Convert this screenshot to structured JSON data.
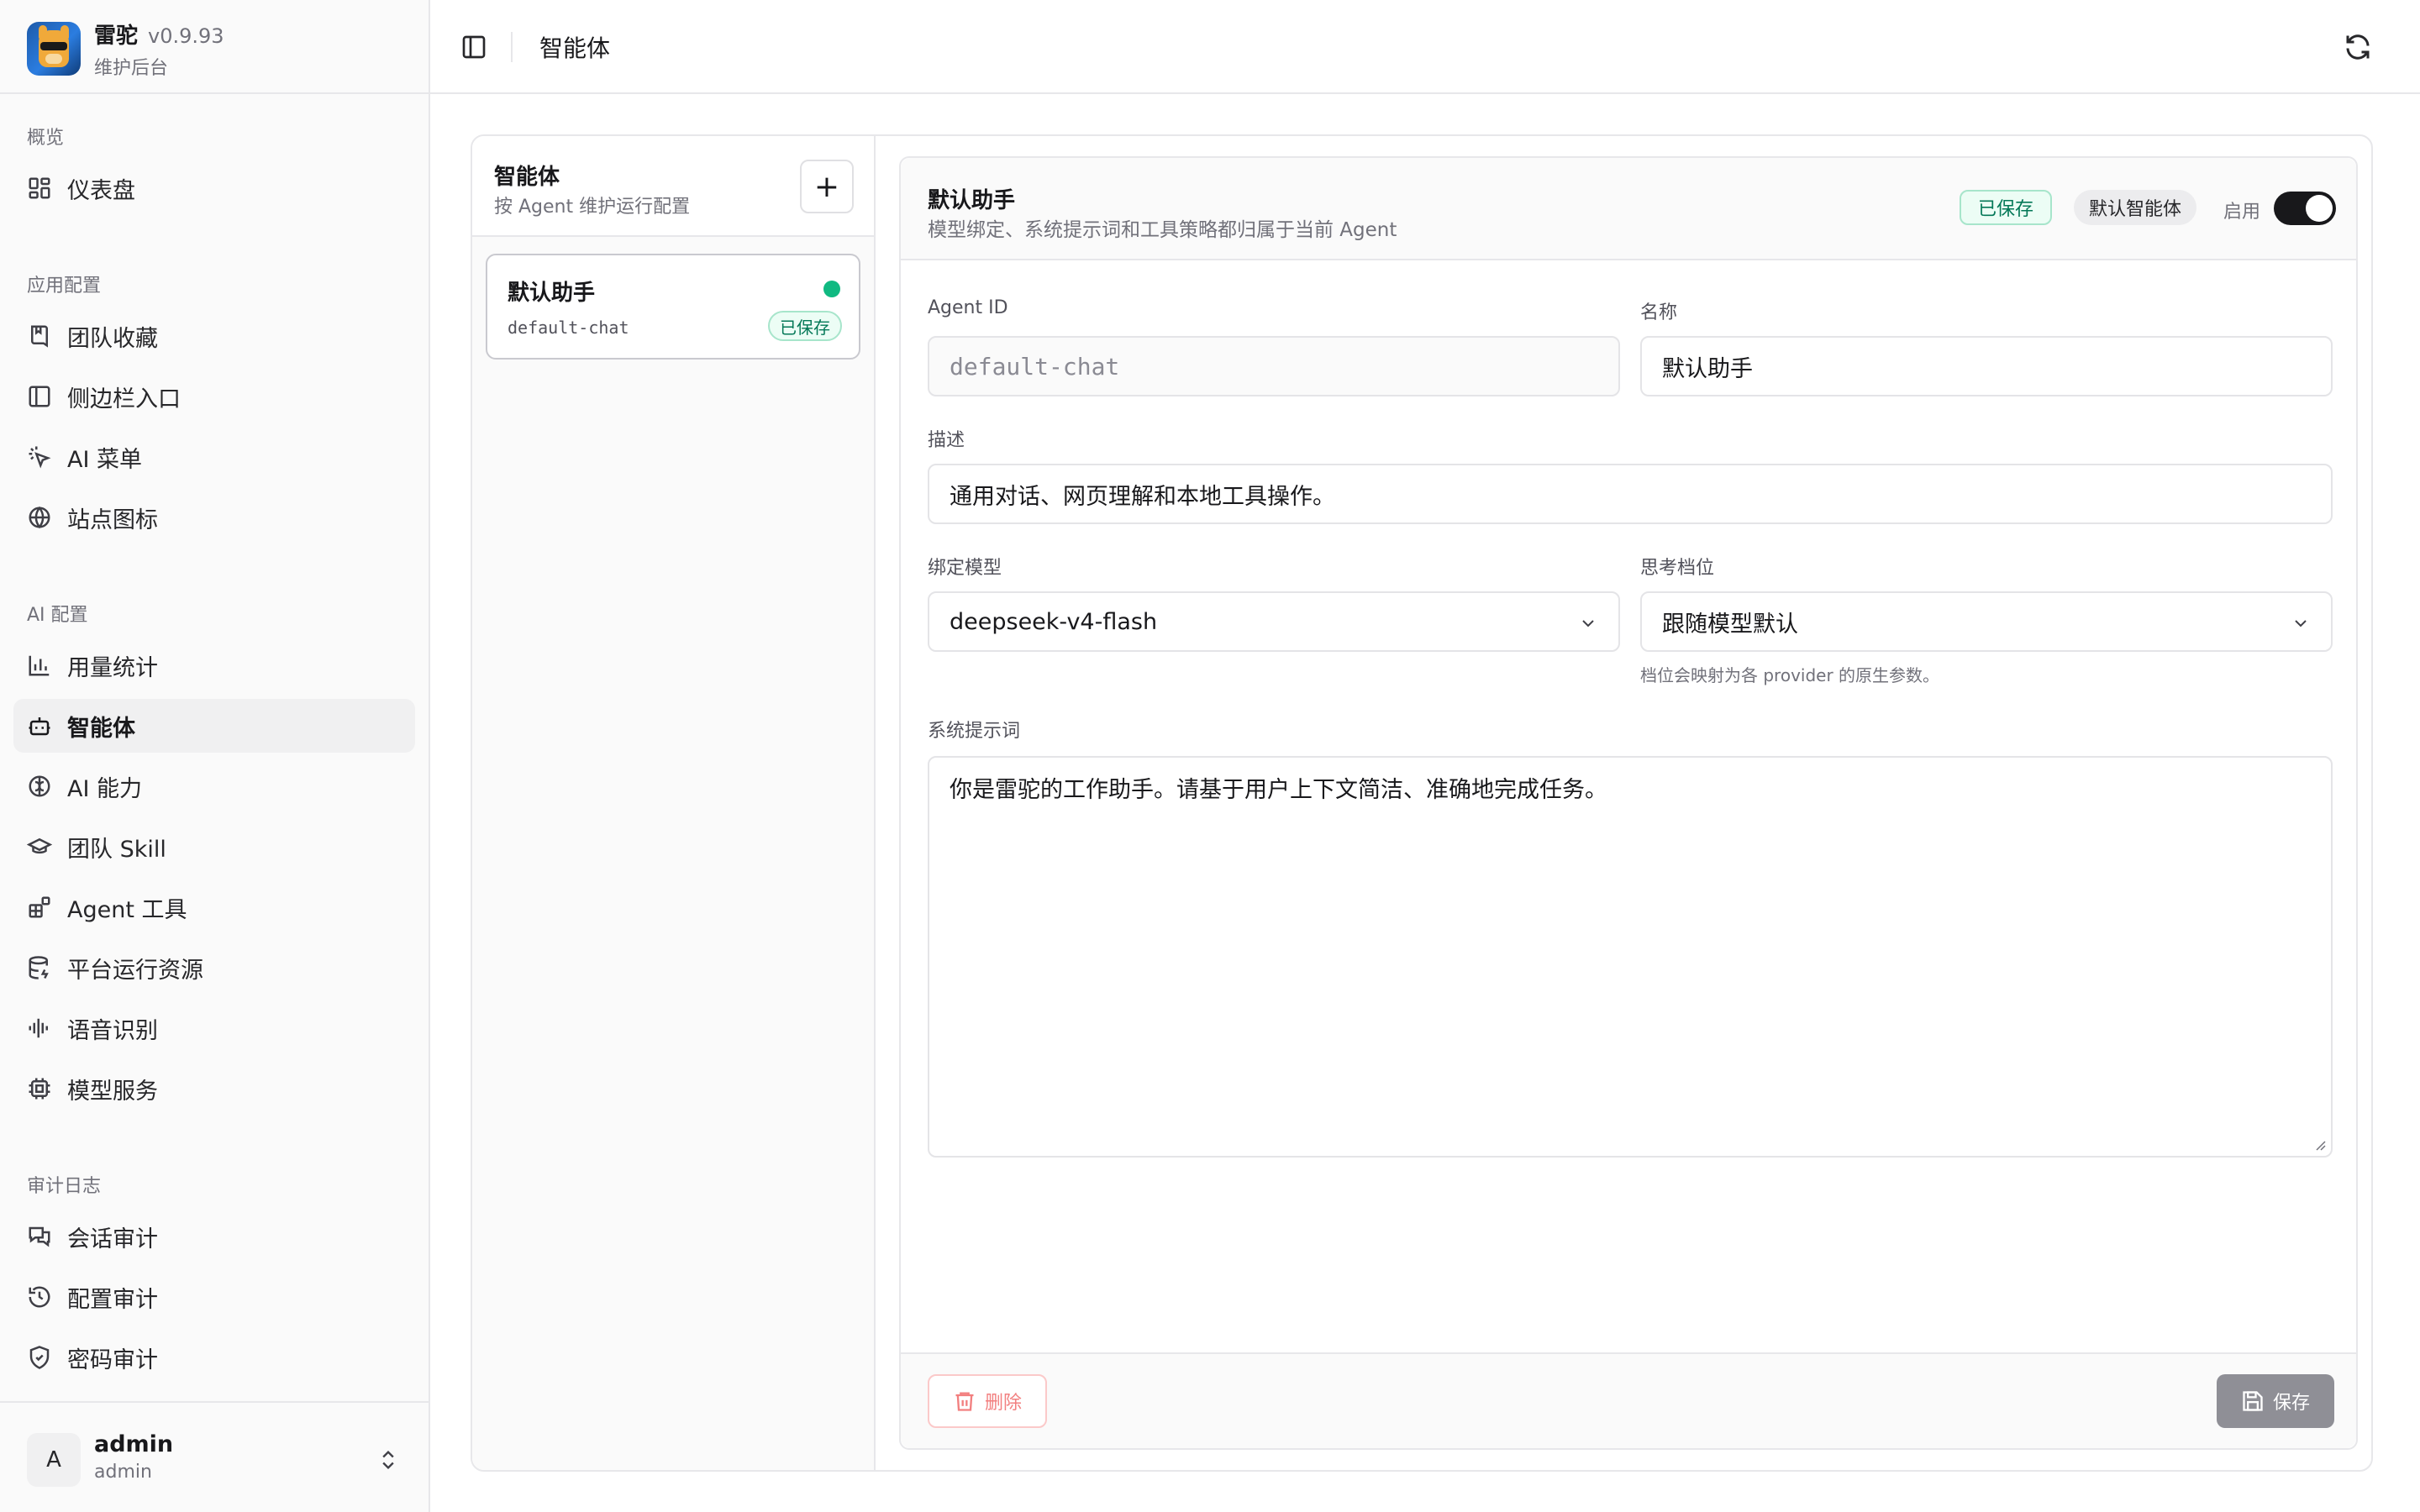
{
  "app": {
    "name": "雷驼",
    "version": "v0.9.93",
    "subtitle": "维护后台"
  },
  "sidebar": {
    "groups": [
      {
        "label": "概览",
        "items": [
          {
            "label": "仪表盘",
            "icon": "dashboard-icon"
          }
        ]
      },
      {
        "label": "应用配置",
        "items": [
          {
            "label": "团队收藏",
            "icon": "bookmark-icon"
          },
          {
            "label": "侧边栏入口",
            "icon": "sidebar-panel-icon"
          },
          {
            "label": "AI 菜单",
            "icon": "pointer-sparkle-icon"
          },
          {
            "label": "站点图标",
            "icon": "globe-icon"
          }
        ]
      },
      {
        "label": "AI 配置",
        "items": [
          {
            "label": "用量统计",
            "icon": "bar-chart-icon"
          },
          {
            "label": "智能体",
            "icon": "bot-icon",
            "active": true
          },
          {
            "label": "AI 能力",
            "icon": "brain-icon"
          },
          {
            "label": "团队 Skill",
            "icon": "graduation-cap-icon"
          },
          {
            "label": "Agent 工具",
            "icon": "blocks-icon"
          },
          {
            "label": "平台运行资源",
            "icon": "database-icon"
          },
          {
            "label": "语音识别",
            "icon": "audio-waveform-icon"
          },
          {
            "label": "模型服务",
            "icon": "cpu-icon"
          }
        ]
      },
      {
        "label": "审计日志",
        "items": [
          {
            "label": "会话审计",
            "icon": "messages-icon"
          },
          {
            "label": "配置审计",
            "icon": "history-icon"
          },
          {
            "label": "密码审计",
            "icon": "shield-icon"
          }
        ]
      }
    ]
  },
  "user": {
    "initial": "A",
    "name": "admin",
    "role": "admin"
  },
  "topbar": {
    "breadcrumb": "智能体"
  },
  "agent_list": {
    "title": "智能体",
    "subtitle": "按 Agent 维护运行配置",
    "add_label": "+",
    "items": [
      {
        "name": "默认助手",
        "id": "default-chat",
        "status": "已保存",
        "active": true,
        "status_color": "#10b981"
      }
    ]
  },
  "detail": {
    "title": "默认助手",
    "subtitle": "模型绑定、系统提示词和工具策略都归属于当前 Agent",
    "saved_badge": "已保存",
    "default_badge": "默认智能体",
    "enable_label": "启用",
    "enabled": true,
    "fields": {
      "agent_id": {
        "label": "Agent ID",
        "value": "default-chat"
      },
      "name": {
        "label": "名称",
        "value": "默认助手"
      },
      "description": {
        "label": "描述",
        "value": "通用对话、网页理解和本地工具操作。"
      },
      "model": {
        "label": "绑定模型",
        "value": "deepseek-v4-flash"
      },
      "thinking": {
        "label": "思考档位",
        "value": "跟随模型默认",
        "hint": "档位会映射为各 provider 的原生参数。"
      },
      "system_prompt": {
        "label": "系统提示词",
        "value": "你是雷驼的工作助手。请基于用户上下文简洁、准确地完成任务。"
      }
    },
    "delete_label": "删除",
    "save_label": "保存"
  },
  "colors": {
    "accent_dark": "#18181b",
    "success": "#10b981",
    "danger": "#f27f7f",
    "muted_button": "#8f8f96"
  }
}
